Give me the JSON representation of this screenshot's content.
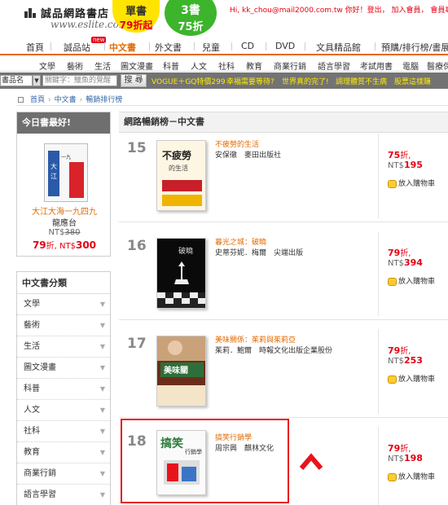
{
  "header": {
    "logo_zh": "誠品網路書店",
    "logo_en": "www.eslite.com",
    "promo1_line1": "單書",
    "promo1_line2": "79折起",
    "promo2_line1": "3書",
    "promo2_line2": "75折",
    "top_links": "Hi, kk_chou@mail2000.com.tw 你好！登出， 加入會員， 會員專區",
    "colors": {
      "accent": "#e46a00",
      "promo_yellow": "#ffe400",
      "promo_green": "#3cb42c",
      "price_red": "#e60012"
    }
  },
  "nav": {
    "items": [
      "首頁",
      "誠品站",
      "中文書",
      "外文書",
      "兒童",
      "CD",
      "DVD",
      "文具精品館",
      "預購/排行榜/書展"
    ],
    "new_badge": "new",
    "active": "中文書"
  },
  "subnav": {
    "items": [
      "文學",
      "藝術",
      "生活",
      "圖文漫畫",
      "科普",
      "人文",
      "社科",
      "教育",
      "商業行銷",
      "語言學習",
      "考試用書",
      "電腦",
      "醫療保健"
    ]
  },
  "search": {
    "select_value": "書品名",
    "placeholder": "關鍵字：鱷魚的覺醒",
    "button": "搜 尋",
    "links": [
      "VOGUE＋GQ特價299",
      "幸福需要等待?",
      "世界真的完了!",
      "調理體質不生病",
      "股票這樣賺"
    ]
  },
  "breadcrumb": [
    "首頁",
    "中文書",
    "暢銷排行榜"
  ],
  "today_best": {
    "header": "今日書最好!",
    "title": "大江大海一九四九",
    "publisher": "龍應台",
    "orig_label": "NT$",
    "orig_price": "380",
    "discount": "79",
    "discount_suffix": "折,",
    "price_prefix": "NT$",
    "price": "300"
  },
  "categories": {
    "header": "中文書分類",
    "items": [
      "文學",
      "藝術",
      "生活",
      "圖文漫畫",
      "科普",
      "人文",
      "社科",
      "教育",
      "商業行銷",
      "語言學習"
    ]
  },
  "main": {
    "header": "網路暢銷榜－中文書",
    "cart_label": "放入購物車",
    "entries": [
      {
        "rank": "15",
        "title": "不疲勞的生活",
        "author": "安保徹",
        "publisher": "麥田出版社",
        "discount": "75",
        "discount_suffix": "折,",
        "price_prefix": "NT$",
        "price": "195",
        "cover_text": "不疲勞的生活"
      },
      {
        "rank": "16",
        "title": "暮光之城：破曉",
        "author": "史蒂芬妮．梅爾",
        "publisher": "尖端出版",
        "discount": "79",
        "discount_suffix": "折,",
        "price_prefix": "NT$",
        "price": "394",
        "cover_text": "破曉"
      },
      {
        "rank": "17",
        "title": "美味關係：茱莉與茱莉亞",
        "author": "茱莉．鮑爾",
        "publisher": "時報文化出版企業股份",
        "discount": "79",
        "discount_suffix": "折,",
        "price_prefix": "NT$",
        "price": "253",
        "cover_text": "美味關係"
      },
      {
        "rank": "18",
        "title": "搞笑行銷學",
        "author": "周宗興",
        "publisher": "麒林文化",
        "discount": "79",
        "discount_suffix": "折,",
        "price_prefix": "NT$",
        "price": "198",
        "cover_text": "搞笑行銷學"
      }
    ]
  }
}
